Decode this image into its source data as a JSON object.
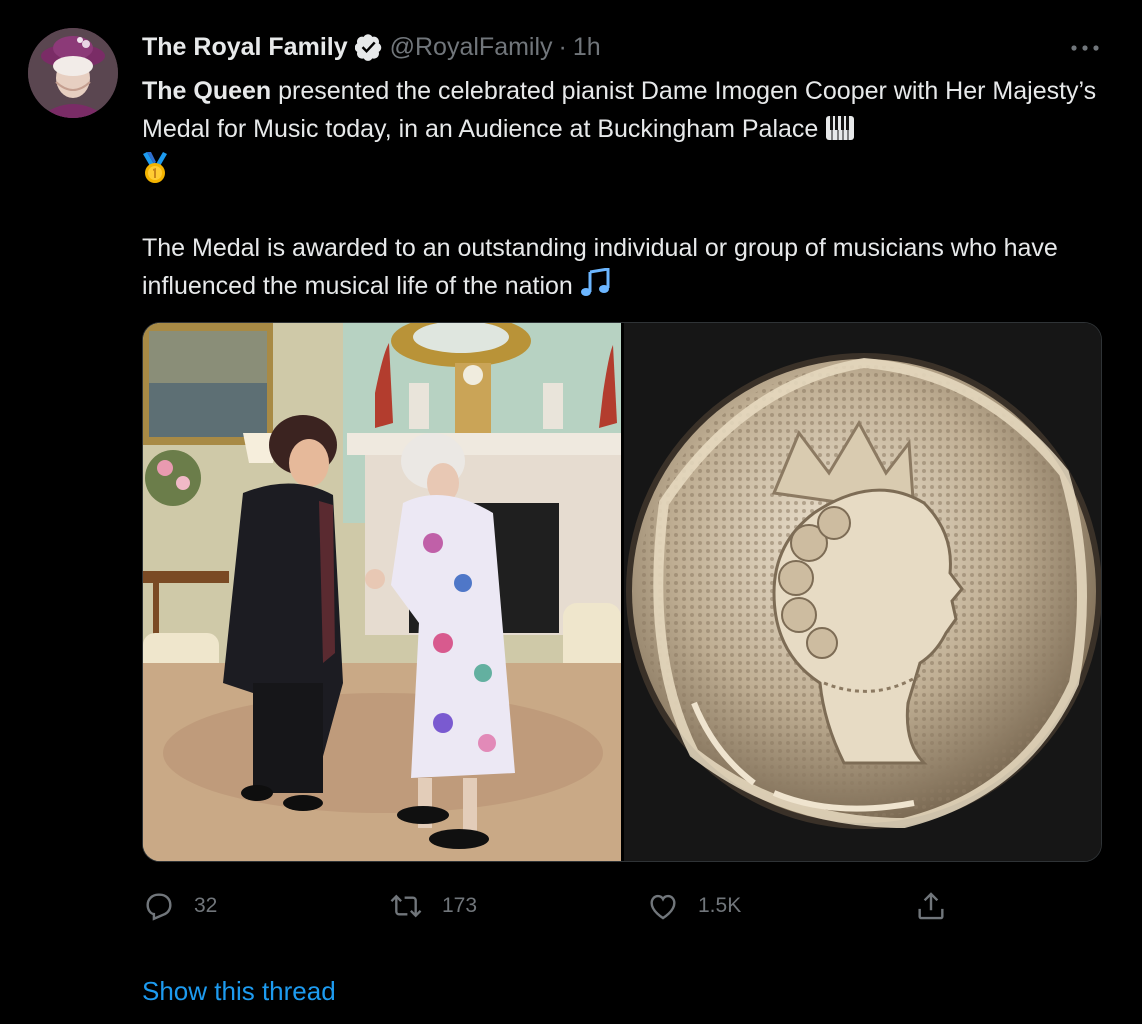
{
  "tweet": {
    "author": {
      "display_name": "The Royal Family",
      "handle": "@RoyalFamily",
      "separator": "·",
      "time": "1h",
      "verified": true
    },
    "text": {
      "bold_lead": "The Queen",
      "line1_rest": " presented the celebrated pianist Dame Imogen Cooper with Her Majesty’s Medal for Music today, in an Audience at Buckingham Palace ",
      "paragraph2": "The Medal is awarded to an outstanding individual or group of musicians who have influenced the musical life of the nation "
    },
    "emojis": [
      "piano-keys-icon",
      "medal-icon",
      "music-notes-icon"
    ],
    "stats": {
      "replies": "32",
      "retweets": "173",
      "likes": "1.5K"
    },
    "show_thread": "Show this thread"
  },
  "colors": {
    "background": "#000000",
    "text": "#e7e9ea",
    "muted": "#71767b",
    "link": "#1d9bf0"
  }
}
